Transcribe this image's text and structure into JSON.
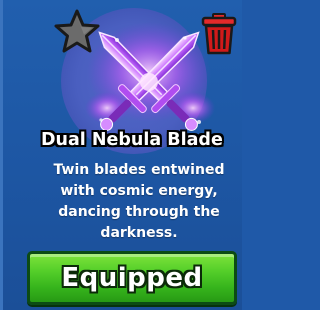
{
  "item": {
    "name": "Dual Nebula Blade",
    "description": "Twin blades entwined\nwith cosmic energy,\ndancing through the\ndarkness."
  },
  "actions": {
    "equip_label": "Equipped"
  },
  "icons": {
    "favorite": "star-icon",
    "delete": "trash-icon"
  },
  "colors": {
    "background": "#1f59a8",
    "halo": "#4a5fc0",
    "star": "#6b6b6b",
    "trash": "#d11a1a",
    "button": "#4fcb27",
    "blade_glow": "#e36bff"
  }
}
